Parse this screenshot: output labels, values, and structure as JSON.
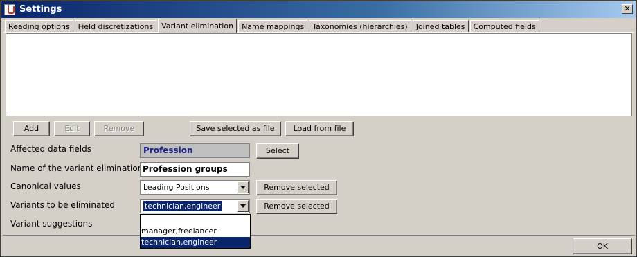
{
  "window": {
    "title": "Settings",
    "close_glyph": "✕"
  },
  "tabs": [
    {
      "label": "Reading options"
    },
    {
      "label": "Field discretizations"
    },
    {
      "label": "Variant elimination",
      "active": true
    },
    {
      "label": "Name mappings"
    },
    {
      "label": "Taxonomies (hierarchies)"
    },
    {
      "label": "Joined tables"
    },
    {
      "label": "Computed fields"
    }
  ],
  "toolbar": {
    "add": "Add",
    "edit": "Edit",
    "remove": "Remove",
    "save_selected": "Save selected as file",
    "load_from_file": "Load from file"
  },
  "form": {
    "affected_fields_label": "Affected data fields",
    "affected_fields_value": "Profession",
    "select_button": "Select",
    "name_label": "Name of the variant elimination",
    "name_value": "Profession groups",
    "canonical_label": "Canonical values",
    "canonical_value": "Leading Positions",
    "canonical_remove": "Remove selected",
    "variants_label": "Variants to be eliminated",
    "variants_value": "technician,engineer",
    "variants_remove": "Remove selected",
    "suggestions_label": "Variant suggestions"
  },
  "dropdown": {
    "items": [
      "",
      "manager,freelancer",
      "technician,engineer"
    ],
    "selected_index": 2
  },
  "footer": {
    "ok": "OK"
  },
  "colors": {
    "title_start": "#0a246a",
    "title_end": "#a6caf0",
    "selection": "#0a246a",
    "field_value": "#1e1e8c"
  }
}
